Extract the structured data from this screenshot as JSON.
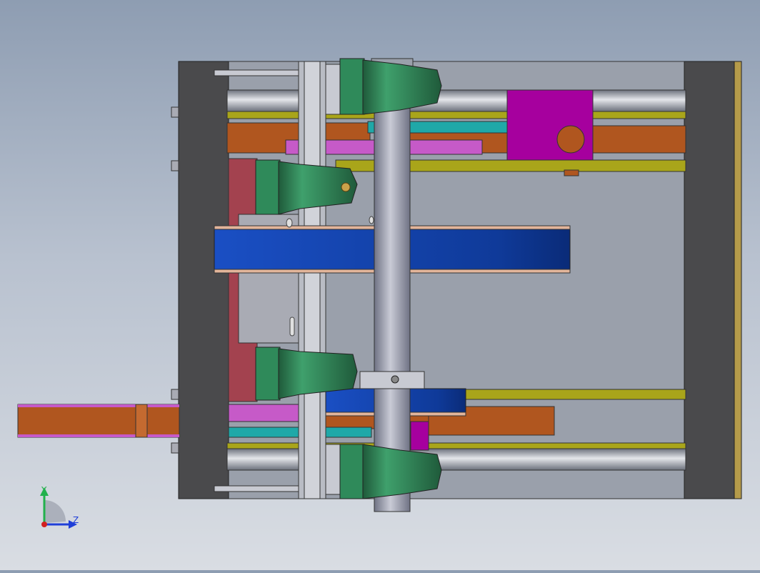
{
  "viewport": {
    "background_top": "#8e9db2",
    "background_bottom": "#d9dde3"
  },
  "triad": {
    "y_label": "Y",
    "z_label": "Z",
    "y_color": "#22b14c",
    "z_color": "#1f3fd8",
    "x_color": "#d22020"
  },
  "colors": {
    "frame_plate": "#4a4a4c",
    "rail": "#9aa1ad",
    "olive_bar": "#a9a51a",
    "copper_bar": "#b0561f",
    "magenta_block": "#a6009e",
    "teal_bar": "#1fa8a8",
    "green_clamp": "#2f8a5a",
    "blue_belt": "#1a4fc4",
    "pink_bar": "#c65ac8",
    "dark_red_plate": "#a3424f",
    "steel_column": "#a7aab8"
  }
}
